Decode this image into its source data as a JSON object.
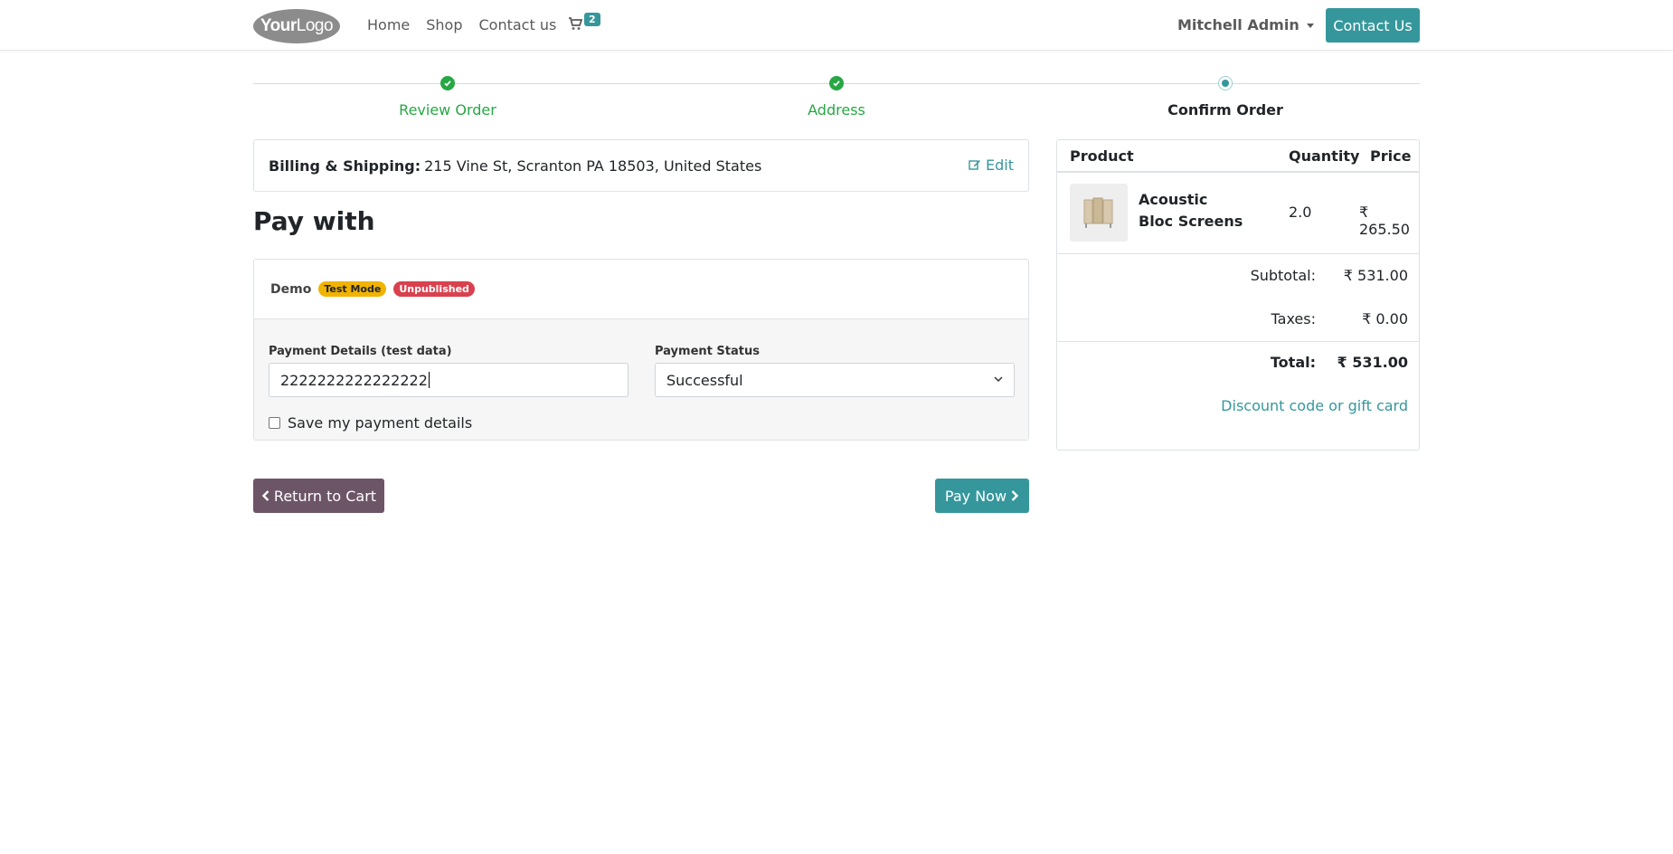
{
  "header": {
    "logo_bold": "Your",
    "logo_light": "Logo",
    "nav": [
      "Home",
      "Shop",
      "Contact us"
    ],
    "cart_count": "2",
    "user": "Mitchell Admin",
    "contact_button": "Contact Us"
  },
  "steps": [
    {
      "label": "Review Order",
      "state": "done"
    },
    {
      "label": "Address",
      "state": "done"
    },
    {
      "label": "Confirm Order",
      "state": "current"
    }
  ],
  "billing": {
    "label": "Billing & Shipping:",
    "address": "215 Vine St, Scranton PA 18503, United States",
    "edit": "Edit"
  },
  "payment": {
    "title": "Pay with",
    "provider": "Demo",
    "badge_test": "Test Mode",
    "badge_unpublished": "Unpublished",
    "details_label": "Payment Details (test data)",
    "details_value": "2222222222222222",
    "status_label": "Payment Status",
    "status_value": "Successful",
    "save_label": "Save my payment details"
  },
  "buttons": {
    "return": "Return to Cart",
    "pay": "Pay Now"
  },
  "summary": {
    "col_product": "Product",
    "col_quantity": "Quantity",
    "col_price": "Price",
    "product_name": "Acoustic Bloc Screens",
    "product_qty": "2.0",
    "product_price": "₹ 265.50",
    "subtotal_label": "Subtotal:",
    "subtotal_value": "₹ 531.00",
    "taxes_label": "Taxes:",
    "taxes_value": "₹ 0.00",
    "total_label": "Total:",
    "total_value": "₹ 531.00",
    "discount_link": "Discount code or gift card"
  },
  "colors": {
    "primary": "#35979c",
    "secondary": "#6d5568",
    "success": "#28a745"
  }
}
